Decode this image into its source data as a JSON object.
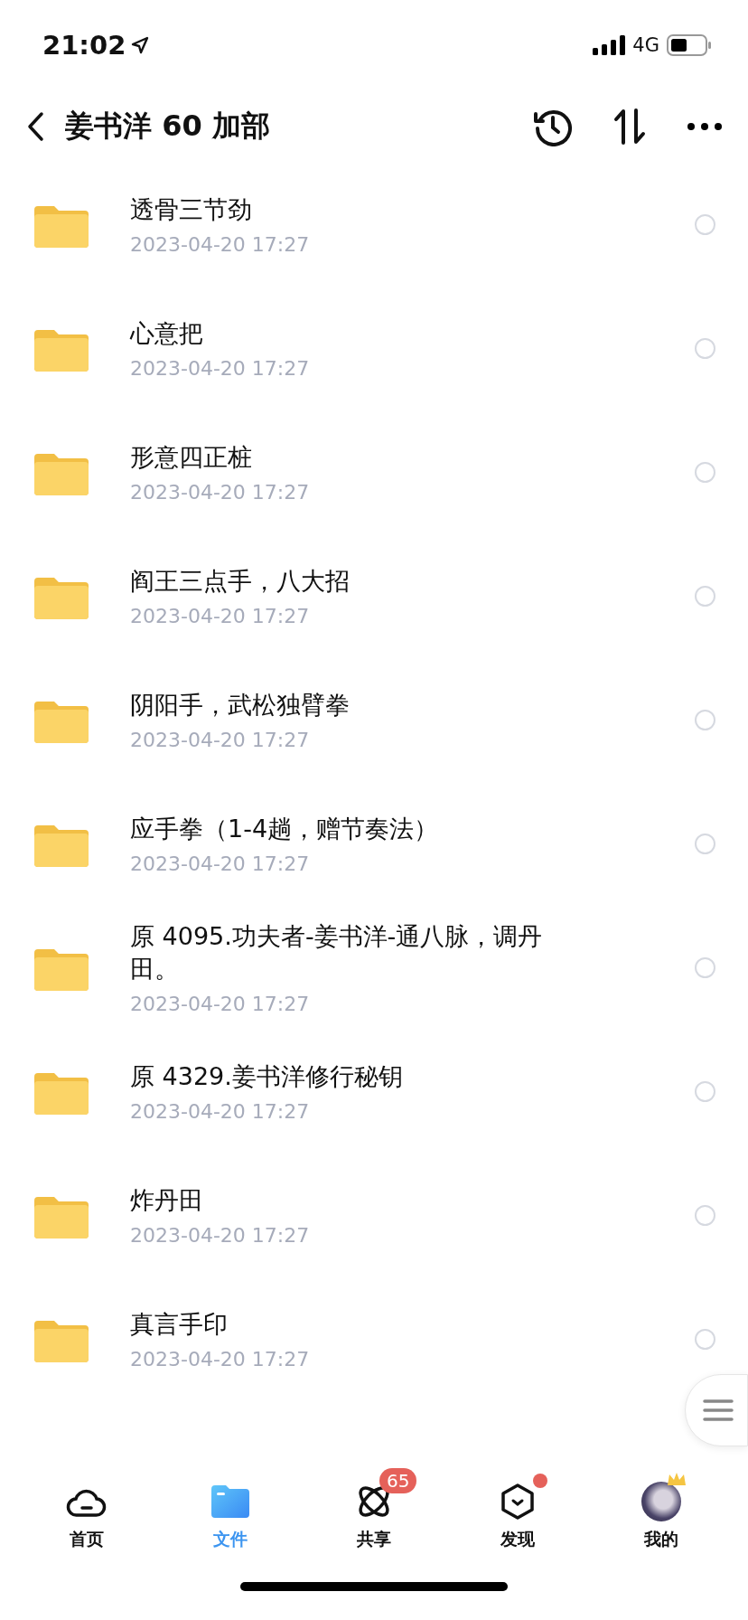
{
  "status_bar": {
    "time": "21:02",
    "network": "4G"
  },
  "header": {
    "title": "姜书洋 60 加部"
  },
  "files": [
    {
      "name": "透骨三节劲",
      "date": "2023-04-20 17:27",
      "selected": false
    },
    {
      "name": "心意把",
      "date": "2023-04-20 17:27",
      "selected": false
    },
    {
      "name": "形意四正桩",
      "date": "2023-04-20 17:27",
      "selected": false
    },
    {
      "name": "阎王三点手，八大招",
      "date": "2023-04-20 17:27",
      "selected": false
    },
    {
      "name": "阴阳手，武松独臂拳",
      "date": "2023-04-20 17:27",
      "selected": false
    },
    {
      "name": "应手拳（1-4趟，赠节奏法）",
      "date": "2023-04-20 17:27",
      "selected": false
    },
    {
      "name": "原 4095.功夫者-姜书洋-通八脉，调丹田。",
      "date": "2023-04-20 17:27",
      "selected": false
    },
    {
      "name": "原 4329.姜书洋修行秘钥",
      "date": "2023-04-20 17:27",
      "selected": false
    },
    {
      "name": "炸丹田",
      "date": "2023-04-20 17:27",
      "selected": false
    },
    {
      "name": "真言手印",
      "date": "2023-04-20 17:27",
      "selected": false
    }
  ],
  "tabs": [
    {
      "kind": "home",
      "label": "首页",
      "selected": false
    },
    {
      "kind": "files",
      "label": "文件",
      "selected": true
    },
    {
      "kind": "share",
      "label": "共享",
      "selected": false,
      "badge": "65"
    },
    {
      "kind": "discover",
      "label": "发现",
      "selected": false,
      "dot": true
    },
    {
      "kind": "me",
      "label": "我的",
      "selected": false
    }
  ]
}
